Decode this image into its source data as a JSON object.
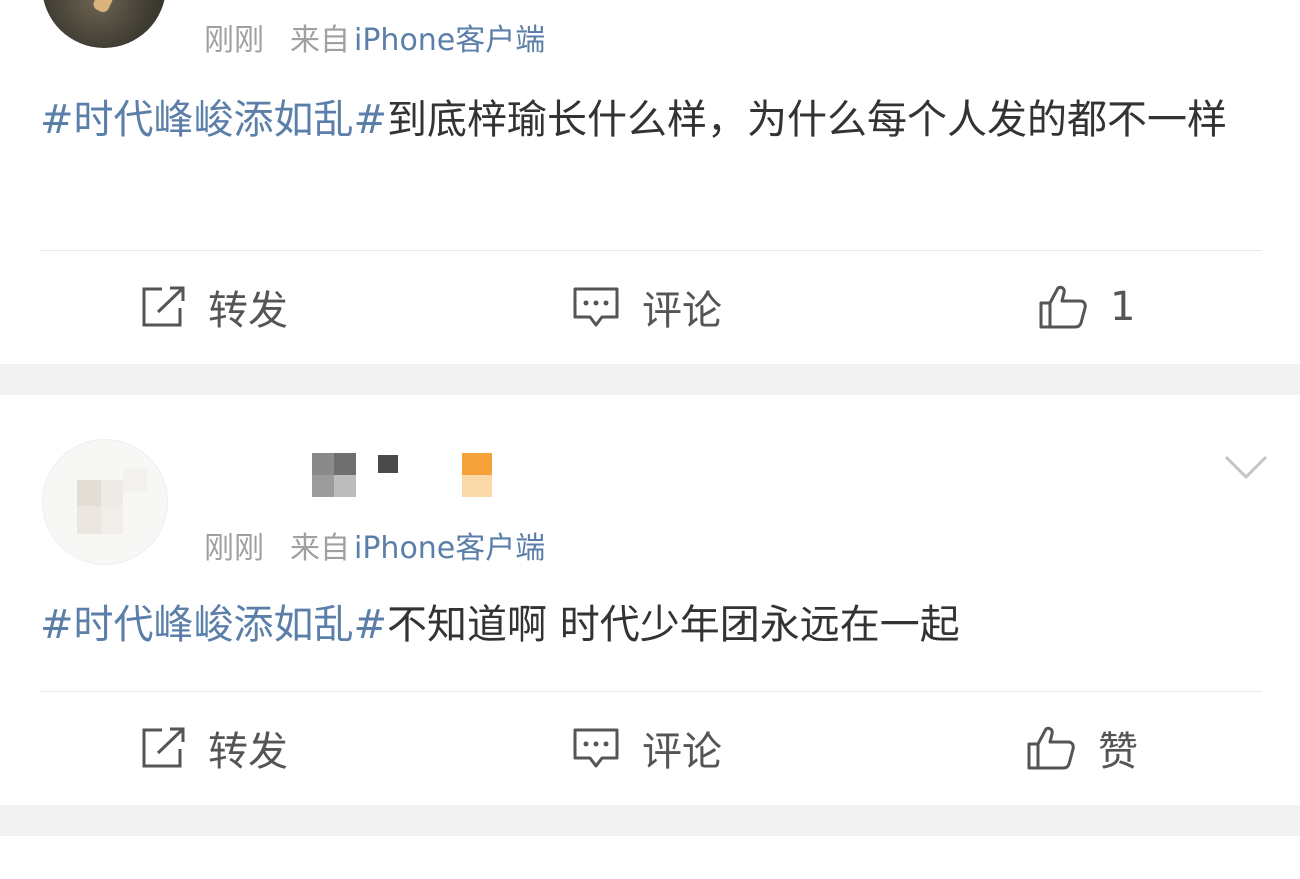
{
  "posts": [
    {
      "meta": {
        "time": "刚刚",
        "source_prefix": "来自",
        "client": "iPhone客户端"
      },
      "text": {
        "hashtag": "#时代峰峻添如乱#",
        "body": "到底梓瑜长什么样，为什么每个人发的都不一样"
      },
      "actions": {
        "repost": "转发",
        "comment": "评论",
        "like": "1"
      }
    },
    {
      "meta": {
        "time": "刚刚",
        "source_prefix": "来自",
        "client": "iPhone客户端"
      },
      "text": {
        "hashtag": "#时代峰峻添如乱#",
        "body": "不知道啊 时代少年团永远在一起"
      },
      "actions": {
        "repost": "转发",
        "comment": "评论",
        "like": "赞"
      }
    }
  ],
  "icons": {
    "repost": "repost-icon",
    "comment": "comment-icon",
    "like": "thumbs-up-icon",
    "more": "chevron-down-icon"
  },
  "colors": {
    "link": "#5b7fa8",
    "meta": "#a0a0a0",
    "text": "#333333",
    "separator": "#f2f2f2"
  }
}
